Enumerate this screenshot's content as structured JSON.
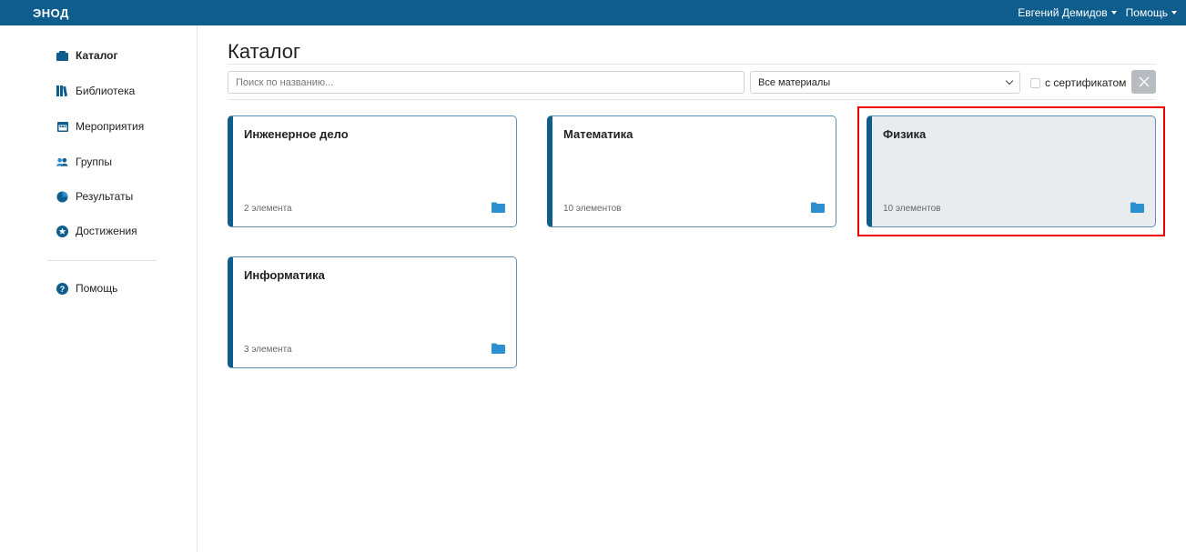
{
  "header": {
    "logo": "ЭНОД",
    "user_menu": "Евгений Демидов",
    "help_menu": "Помощь"
  },
  "sidebar": {
    "items": [
      {
        "label": "Каталог",
        "icon": "catalog-icon",
        "active": true
      },
      {
        "label": "Библиотека",
        "icon": "library-icon",
        "active": false
      },
      {
        "label": "Мероприятия",
        "icon": "calendar-icon",
        "active": false
      },
      {
        "label": "Группы",
        "icon": "users-icon",
        "active": false
      },
      {
        "label": "Результаты",
        "icon": "pie-chart-icon",
        "active": false
      },
      {
        "label": "Достижения",
        "icon": "star-icon",
        "active": false
      },
      {
        "label": "Помощь",
        "icon": "question-icon",
        "active": false
      }
    ]
  },
  "main": {
    "title": "Каталог",
    "search_placeholder": "Поиск по названию...",
    "filter_select": "Все материалы",
    "certificate_label": "с сертификатом",
    "cards": [
      {
        "title": "Инженерное дело",
        "count": "2 элемента"
      },
      {
        "title": "Математика",
        "count": "10 элементов"
      },
      {
        "title": "Физика",
        "count": "10 элементов"
      },
      {
        "title": "Информатика",
        "count": "3 элемента"
      }
    ]
  },
  "colors": {
    "topbar": "#0e5d8c",
    "accent": "#0e5d8c",
    "folder": "#2b8fd0",
    "highlight": "#e00000"
  }
}
